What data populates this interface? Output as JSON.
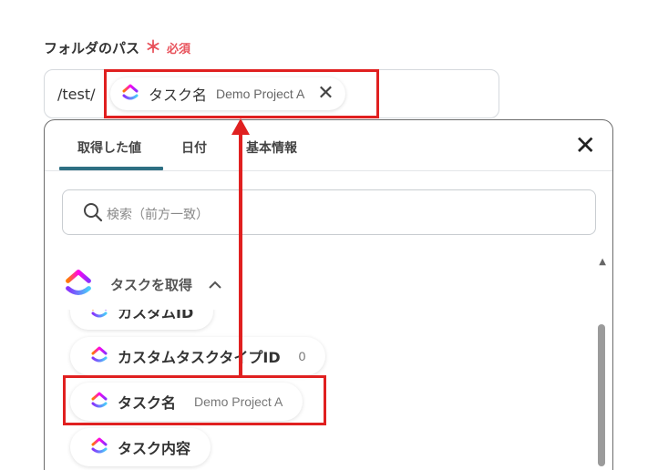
{
  "field": {
    "label": "フォルダのパス",
    "required_mark": "＊",
    "required_text": "必須"
  },
  "path": {
    "prefix": "/test/",
    "chip": {
      "label": "タスク名",
      "sub": "Demo Project A",
      "close_icon": "close-icon"
    }
  },
  "dropdown": {
    "tabs": [
      {
        "label": "取得した値",
        "active": true
      },
      {
        "label": "日付",
        "active": false
      },
      {
        "label": "基本情報",
        "active": false
      }
    ],
    "close_icon": "close-icon",
    "search": {
      "placeholder": "検索（前方一致）",
      "icon": "search-icon"
    },
    "section": {
      "title": "タスクを取得",
      "chevron": "^"
    },
    "items": [
      {
        "label": "カスタムID",
        "value": ""
      },
      {
        "label": "カスタムタスクタイプID",
        "value": "0"
      },
      {
        "label": "タスク名",
        "value": "Demo Project A"
      },
      {
        "label": "タスク内容",
        "value": ""
      }
    ]
  },
  "colors": {
    "accent": "#2e6f83",
    "required": "#e8525b",
    "highlight": "#e02020"
  },
  "icons": {
    "app_logo": "clickup-logo-icon"
  }
}
